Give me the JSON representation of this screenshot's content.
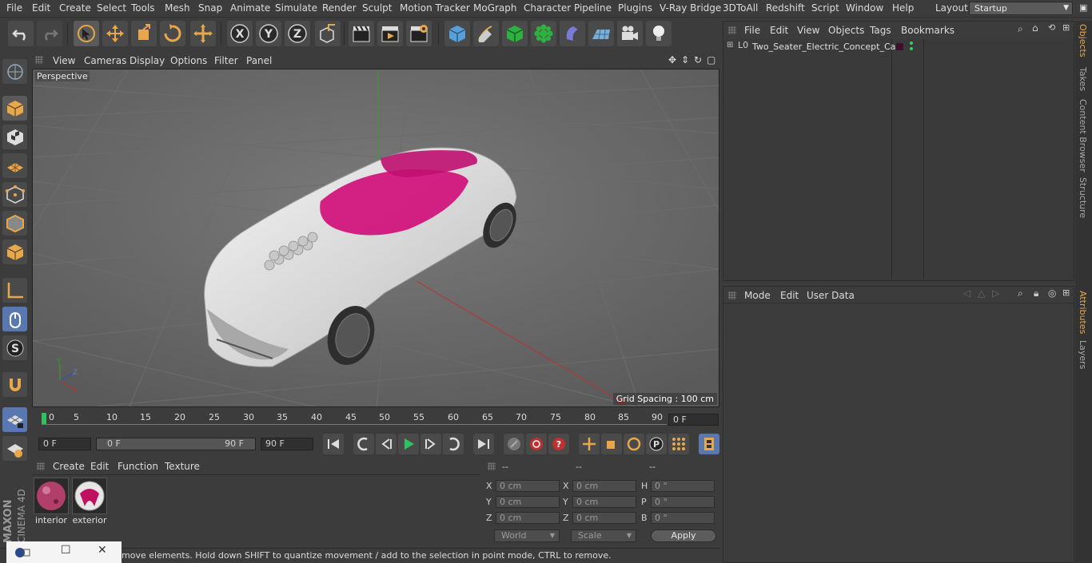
{
  "menubar": {
    "items": [
      "File",
      "Edit",
      "Create",
      "Select",
      "Tools",
      "Mesh",
      "Snap",
      "Animate",
      "Simulate",
      "Render",
      "Sculpt",
      "Motion Tracker",
      "MoGraph",
      "Character",
      "Pipeline",
      "Plugins",
      "V-Ray Bridge",
      "3DToAll",
      "Redshift",
      "Script",
      "Window",
      "Help"
    ],
    "layout_label": "Layout:",
    "layout_value": "Startup"
  },
  "toolbar": {
    "x_axis": "X",
    "y_axis": "Y",
    "z_axis": "Z"
  },
  "viewport": {
    "menus": [
      "View",
      "Cameras",
      "Display",
      "Options",
      "Filter",
      "Panel"
    ],
    "label": "Perspective",
    "grid_spacing": "Grid Spacing : 100 cm"
  },
  "timeline": {
    "ticks": [
      "0",
      "5",
      "10",
      "15",
      "20",
      "25",
      "30",
      "35",
      "40",
      "45",
      "50",
      "55",
      "60",
      "65",
      "70",
      "75",
      "80",
      "85",
      "90"
    ],
    "current_frame": "0 F"
  },
  "transport": {
    "start_field": "0 F",
    "range_start": "0 F",
    "range_end": "90 F",
    "end_field": "90 F"
  },
  "materials": {
    "menus": [
      "Create",
      "Edit",
      "Function",
      "Texture"
    ],
    "items": [
      {
        "name": "interior"
      },
      {
        "name": "exterior"
      }
    ]
  },
  "coordinates": {
    "headers": [
      "--",
      "--",
      "--"
    ],
    "rows": [
      {
        "l1": "X",
        "v1": "0 cm",
        "l2": "X",
        "v2": "0 cm",
        "l3": "H",
        "v3": "0 °"
      },
      {
        "l1": "Y",
        "v1": "0 cm",
        "l2": "Y",
        "v2": "0 cm",
        "l3": "P",
        "v3": "0 °"
      },
      {
        "l1": "Z",
        "v1": "0 cm",
        "l2": "Z",
        "v2": "0 cm",
        "l3": "B",
        "v3": "0 °"
      }
    ],
    "world": "World",
    "scale": "Scale",
    "apply": "Apply"
  },
  "status": {
    "text": "move elements. Hold down SHIFT to quantize movement / add to the selection in point mode, CTRL to remove."
  },
  "objects_panel": {
    "menus": [
      "File",
      "Edit",
      "View",
      "Objects",
      "Tags",
      "Bookmarks"
    ],
    "object_name": "Two_Seater_Electric_Concept_Car"
  },
  "attributes_panel": {
    "menus": [
      "Mode",
      "Edit",
      "User Data"
    ]
  },
  "right_tabs": [
    "Objects",
    "Takes",
    "Content Browser",
    "Structure",
    "Attributes",
    "Layers"
  ],
  "branding": {
    "maxon": "MAXON",
    "product": "CINEMA 4D"
  },
  "colors": {
    "accent_orange": "#e8a84a",
    "seat_pink": "#d0107a",
    "axis_red": "#c03030",
    "axis_green": "#30a030"
  }
}
